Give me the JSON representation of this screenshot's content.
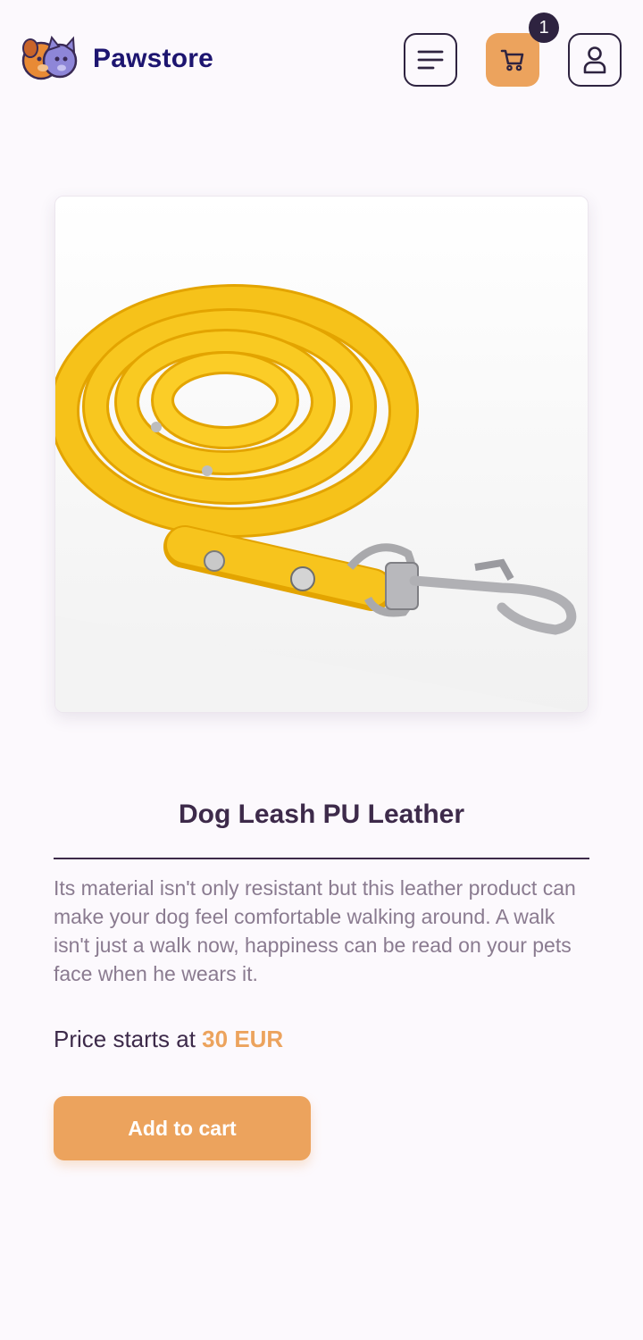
{
  "header": {
    "brand": "Pawstore",
    "cart_count": "1"
  },
  "icons": {
    "logo": "pet-logo-icon",
    "menu": "menu-icon",
    "cart": "cart-icon",
    "user": "user-icon"
  },
  "colors": {
    "brand": "#1d1570",
    "accent": "#eca35d",
    "dark": "#3d2a4a",
    "muted": "#8a7b90"
  },
  "product": {
    "title": "Dog Leash PU Leather",
    "description": "Its material isn't only resistant but this leather product can make your dog feel comfortable walking around. A walk isn't just a walk now, happiness can be read on your pets face when he wears it.",
    "price_prefix": "Price starts at",
    "price": "30 EUR",
    "add_to_cart": "Add to cart"
  }
}
